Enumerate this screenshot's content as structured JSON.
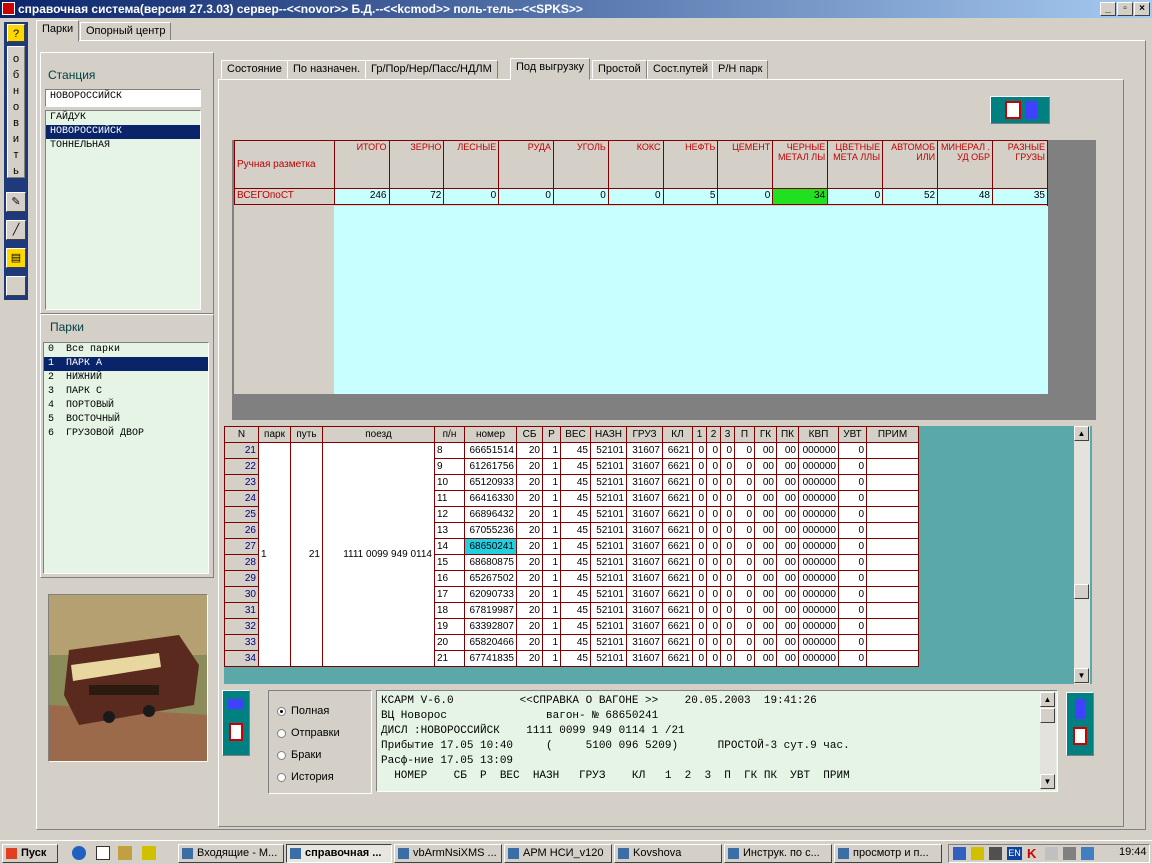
{
  "window": {
    "title": "справочная система(версия 27.3.03) сервер--<<novor>> Б.Д.--<<kcmod>> поль-тель--<<SPKS>>",
    "min": "_",
    "max": "▫",
    "close": "×"
  },
  "lefttool": {
    "refresh_letters": [
      "о",
      "б",
      "н",
      "о",
      "в",
      "и",
      "т",
      "ь"
    ],
    "help": "?"
  },
  "toptabs": [
    "Парки",
    "Опорный центр"
  ],
  "station": {
    "label": "Станция",
    "value": "НОВОРОССИЙСК",
    "items": [
      "ГАЙДУК",
      "НОВОРОССИЙСК",
      "ТОННЕЛЬНАЯ"
    ],
    "selected": 1
  },
  "parks": {
    "label": "Парки",
    "items": [
      "0  Все парки",
      "1  ПАРК А",
      "2  НИЖНИЙ",
      "3  ПАРК С",
      "4  ПОРТОВЫЙ",
      "5  ВОСТОЧНЫЙ",
      "6  ГРУЗОВОЙ ДВОР"
    ],
    "selected": 1
  },
  "tabs": [
    "Состояние",
    "По назначен.",
    "Гр/Пор/Нер/Пасс/НДЛМ",
    "Под выгрузку",
    "Простой",
    "Сост.путей",
    "Р/Н парк"
  ],
  "active_tab": 3,
  "summary": {
    "row_header": "Ручная разметка",
    "columns": [
      "ИТОГО",
      "ЗЕРНО",
      "ЛЕСНЫЕ",
      "РУДА",
      "УГОЛЬ",
      "КОКС",
      "НЕФТЬ",
      "ЦЕМЕНТ",
      "ЧЕРНЫЕ МЕТАЛ ЛЫ",
      "ЦВЕТНЫЕ МЕТА ЛЛЫ",
      "АВТОМОБ ИЛИ",
      "МИНЕРАЛ . УД ОБР",
      "РАЗНЫЕ ГРУЗЫ"
    ],
    "row_label": "ВСЕГОпоСТ",
    "values": [
      "246",
      "72",
      "0",
      "0",
      "0",
      "0",
      "5",
      "0",
      "34",
      "0",
      "52",
      "48",
      "35"
    ]
  },
  "grid": {
    "headers": [
      "N",
      "парк",
      "путь",
      "поезд",
      "п/н",
      "номер",
      "СБ",
      "Р",
      "ВЕС",
      "НАЗН",
      "ГРУЗ",
      "КЛ",
      "1",
      "2",
      "3",
      "П",
      "ГК",
      "ПК",
      "КВП",
      "УВТ",
      "ПРИМ"
    ],
    "park": "1",
    "track": "21",
    "train": "1111 0099 949 0114",
    "rows": [
      [
        "21",
        "8",
        "66651514"
      ],
      [
        "22",
        "9",
        "61261756"
      ],
      [
        "23",
        "10",
        "65120933"
      ],
      [
        "24",
        "11",
        "66416330"
      ],
      [
        "25",
        "12",
        "66896432"
      ],
      [
        "26",
        "13",
        "67055236"
      ],
      [
        "27",
        "14",
        "68650241"
      ],
      [
        "28",
        "15",
        "68680875"
      ],
      [
        "29",
        "16",
        "65267502"
      ],
      [
        "30",
        "17",
        "62090733"
      ],
      [
        "31",
        "18",
        "67819987"
      ],
      [
        "32",
        "19",
        "63392807"
      ],
      [
        "33",
        "20",
        "65820466"
      ],
      [
        "34",
        "21",
        "67741835"
      ]
    ],
    "common": [
      "20",
      "1",
      "45",
      "52101",
      "31607",
      "6621",
      "0",
      "0",
      "0",
      "0",
      "00",
      "00",
      "000000",
      "0",
      ""
    ],
    "selected_row": 6
  },
  "radios": {
    "items": [
      "Полная",
      "Отправки",
      "Браки",
      "История"
    ],
    "selected": 0
  },
  "memo": {
    "lines": [
      "КСАРМ V-6.0          <<СПРАВКА О ВАГОНЕ >>    20.05.2003  19:41:26",
      "ВЦ Новорос               вагон- № 68650241",
      "ДИСЛ :НОВОРОССИЙСК    1111 0099 949 0114 1 /21",
      "Прибытие 17.05 10:40     (     5100 096 5209)      ПРОСТОЙ-3 сут.9 час.",
      "Расф-ние 17.05 13:09",
      "  НОМЕР    СБ  Р  ВЕС  НАЗН   ГРУЗ    КЛ   1  2  3  П  ГК ПК  УВТ  ПРИМ"
    ]
  },
  "taskbar": {
    "start": "Пуск",
    "tasks": [
      "Входящие - M...",
      "справочная ...",
      "vbArmNsiXMS ...",
      "АРМ НСИ_v120",
      "Kovshova",
      "Инструк. по с...",
      "просмотр и п..."
    ],
    "active": 1,
    "tray_lang": "EN",
    "clock": "19:44"
  }
}
